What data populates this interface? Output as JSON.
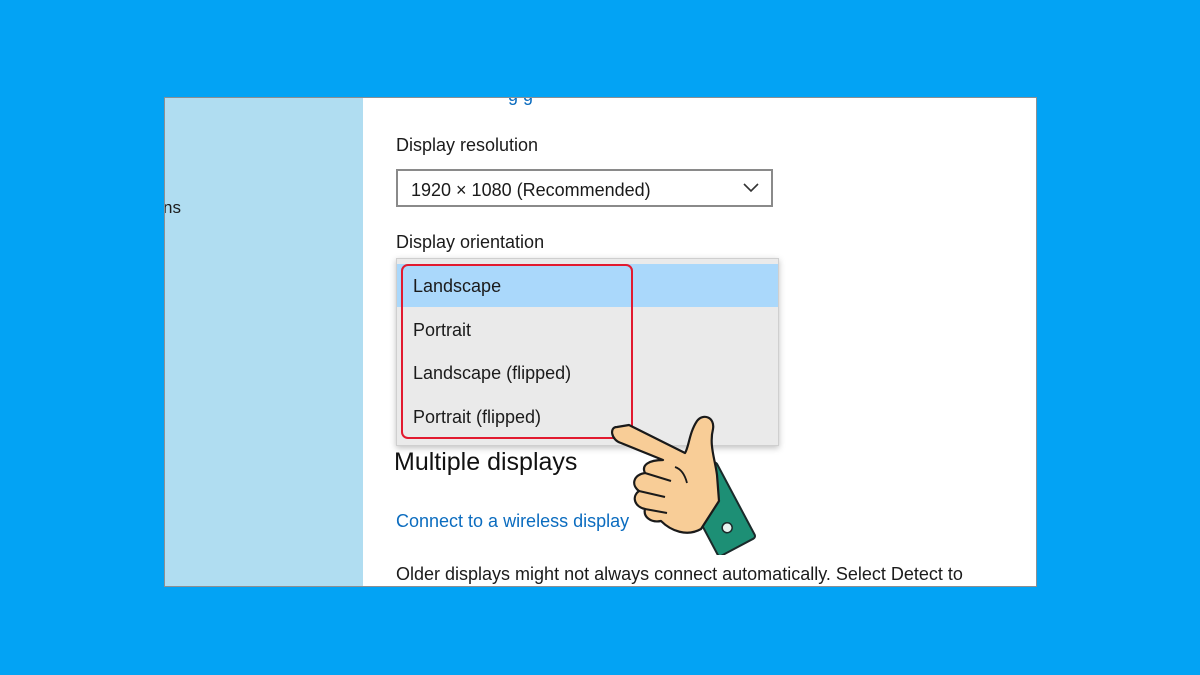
{
  "sidebar": {
    "fragment_text": "ns"
  },
  "main": {
    "top_link_fragment": "g g",
    "display_resolution": {
      "label": "Display resolution",
      "selected_value": "1920 × 1080 (Recommended)"
    },
    "display_orientation": {
      "label": "Display orientation",
      "options": [
        "Landscape",
        "Portrait",
        "Landscape (flipped)",
        "Portrait (flipped)"
      ],
      "highlighted_option": "Landscape"
    },
    "multiple_displays": {
      "heading": "Multiple displays",
      "wireless_link": "Connect to a wireless display",
      "detect_text": "Older displays might not always connect automatically. Select Detect to"
    }
  },
  "colors": {
    "background": "#03a3f4",
    "sidebar": "#b0ddf1",
    "selected_item": "#aad8fb",
    "link": "#0b6cbf",
    "highlight_outline": "#e21a2f"
  },
  "icons": {
    "dropdown_chevron": "chevron-down-icon",
    "pointer": "pointing-hand-icon"
  }
}
